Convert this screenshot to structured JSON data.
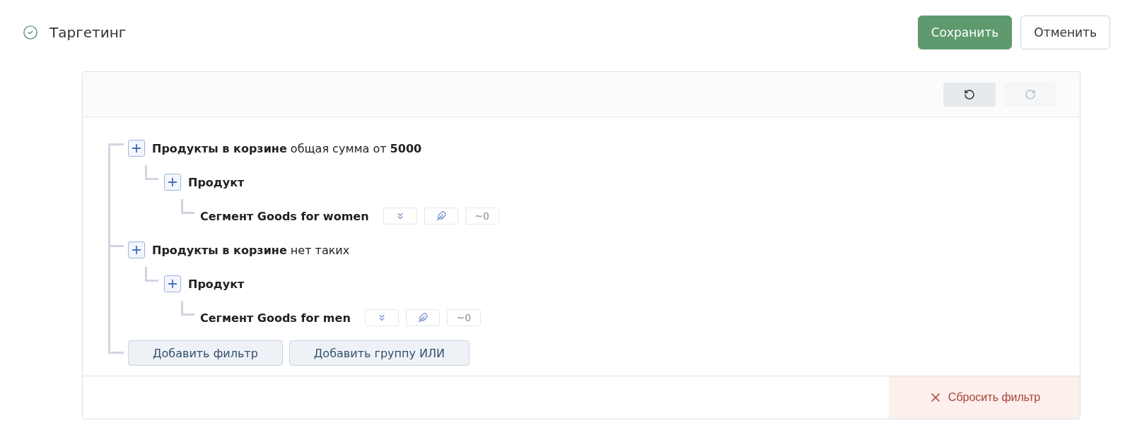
{
  "header": {
    "title": "Таргетинг",
    "buttons": [
      {
        "label": "Сохранить",
        "kind": "primary"
      },
      {
        "label": "Отменить",
        "kind": "secondary"
      }
    ]
  },
  "toolbar": {
    "buttons": [
      {
        "kind": "undo",
        "disabled": false
      },
      {
        "kind": "redo",
        "disabled": true
      }
    ]
  },
  "tree": [
    {
      "kind": "group",
      "text": "**Продукты в корзине** общая сумма от **5000**",
      "children": [
        {
          "kind": "group",
          "text": "Продукт",
          "children": [
            {
              "kind": "segment",
              "text": "Сегмент Goods for women",
              "count": "~0"
            }
          ]
        }
      ]
    },
    {
      "kind": "group",
      "text": "**Продукты в корзине** нет таких",
      "children": [
        {
          "kind": "group",
          "text": "Продукт",
          "children": [
            {
              "kind": "segment",
              "text": "Сегмент Goods for men",
              "count": "~0"
            }
          ]
        }
      ]
    }
  ],
  "actions": [
    "Добавить фильтр",
    "Добавить группу ИЛИ"
  ],
  "footer": {
    "reset": "Сбросить фильтр"
  }
}
